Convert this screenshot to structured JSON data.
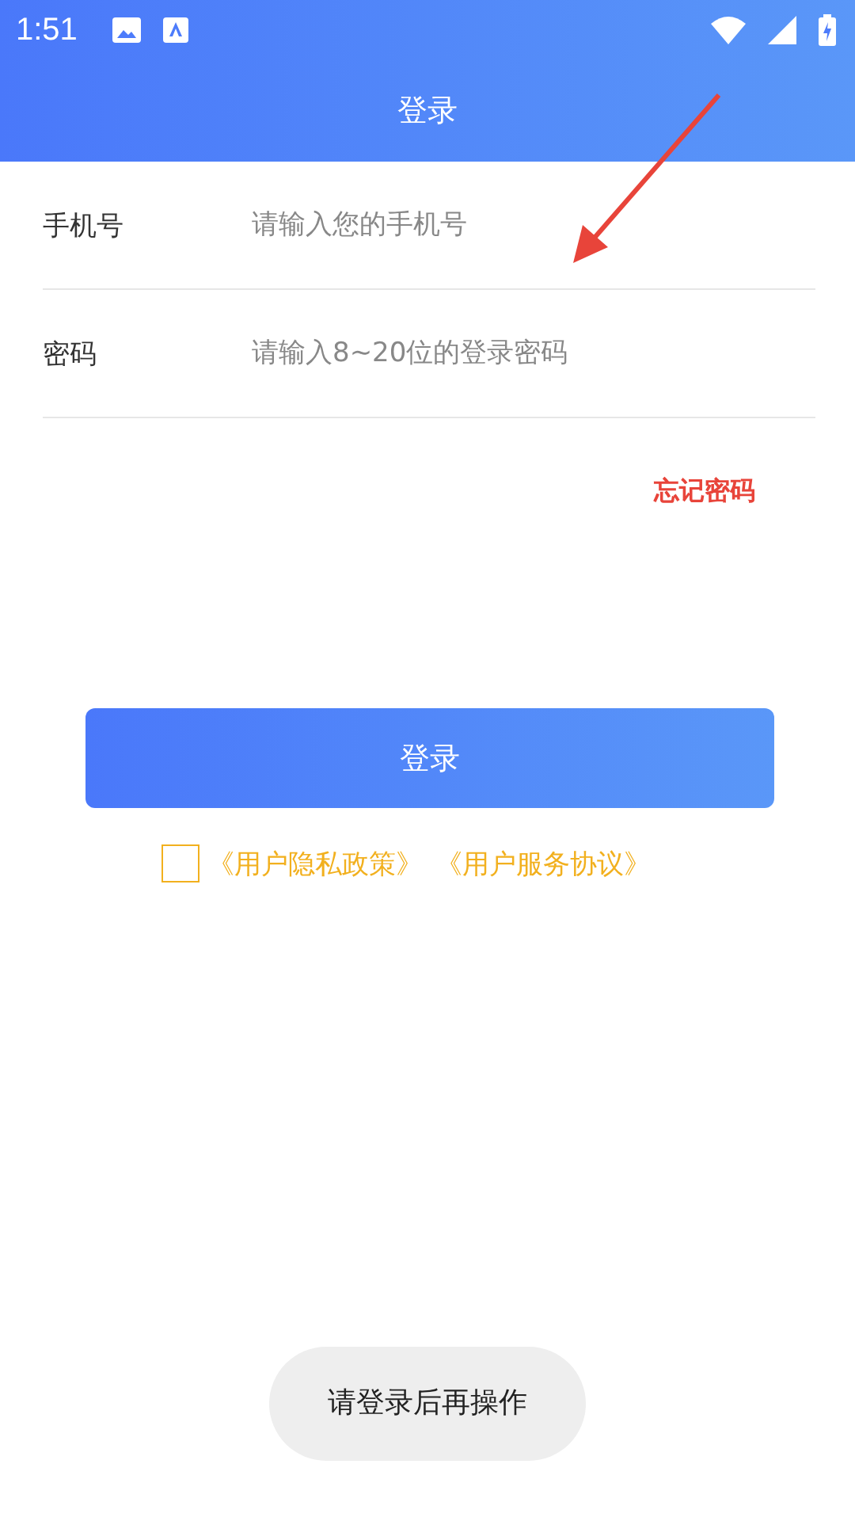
{
  "status_bar": {
    "time": "1:51"
  },
  "header": {
    "title": "登录"
  },
  "fields": [
    {
      "label": "手机号",
      "placeholder": "请输入您的手机号"
    },
    {
      "label": "密码",
      "placeholder": "请输入8~20位的登录密码"
    }
  ],
  "forgot_link": "忘记密码",
  "login_button": "登录",
  "agreement": {
    "checked": false,
    "links": [
      "《用户隐私政策》",
      "《用户服务协议》"
    ]
  },
  "toast": "请登录后再操作"
}
